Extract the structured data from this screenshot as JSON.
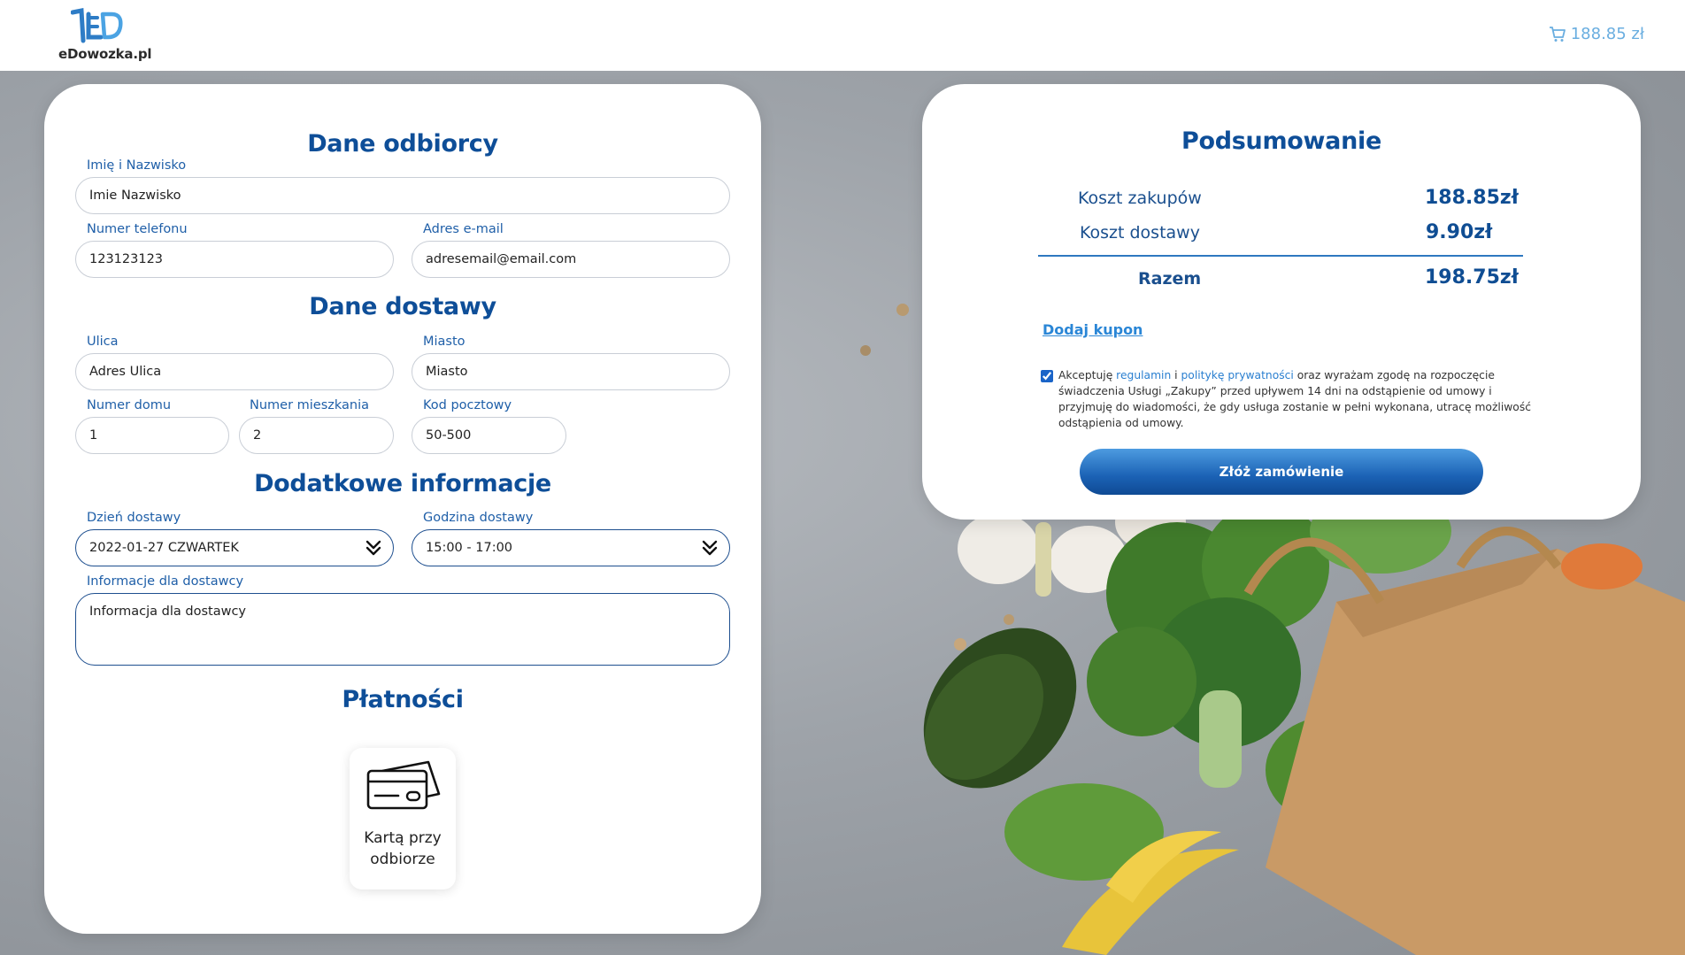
{
  "header": {
    "logo_text": "eDowozka.pl",
    "cart_total": "188.85 zł",
    "accent_color": "#6aaee0"
  },
  "form": {
    "recipient_title": "Dane odbiorcy",
    "name_label": "Imię i Nazwisko",
    "name_value": "Imie Nazwisko",
    "phone_label": "Numer telefonu",
    "phone_value": "123123123",
    "email_label": "Adres e-mail",
    "email_value": "adresemail@email.com",
    "delivery_title": "Dane dostawy",
    "street_label": "Ulica",
    "street_value": "Adres Ulica",
    "city_label": "Miasto",
    "city_value": "Miasto",
    "house_label": "Numer domu",
    "house_value": "1",
    "flat_label": "Numer mieszkania",
    "flat_value": "2",
    "postal_label": "Kod pocztowy",
    "postal_value": "50-500",
    "extra_title": "Dodatkowe informacje",
    "day_label": "Dzień dostawy",
    "day_value": "2022-01-27 CZWARTEK",
    "hour_label": "Godzina dostawy",
    "hour_value": "15:00 - 17:00",
    "notes_label": "Informacje dla dostawcy",
    "notes_value": "Informacja dla dostawcy",
    "payments_title": "Płatności",
    "payment_option_line1": "Kartą przy",
    "payment_option_line2": "odbiorze"
  },
  "summary": {
    "title": "Podsumowanie",
    "products_label": "Koszt zakupów",
    "products_value": "188.85zł",
    "delivery_label": "Koszt dostawy",
    "delivery_value": "9.90zł",
    "total_label": "Razem",
    "total_value": "198.75zł",
    "coupon_label": "Dodaj kupon",
    "consent_prefix": "Akceptuję ",
    "consent_link1": "regulamin",
    "consent_mid": " i ",
    "consent_link2": "politykę prywatności",
    "consent_rest": " oraz wyrażam zgodę na rozpoczęcie świadczenia Usługi „Zakupy” przed upływem 14 dni na odstąpienie od umowy i przyjmuję do wiadomości, że gdy usługa zostanie w pełni wykonana, utracę możliwość odstąpienia od umowy.",
    "consent_checked": true,
    "order_button": "Złóż zamówienie"
  },
  "colors": {
    "title_blue": "#0e4e98",
    "label_blue": "#1f5fa8",
    "button_blue": "#1b62b5",
    "link_blue": "#2a86d6"
  }
}
